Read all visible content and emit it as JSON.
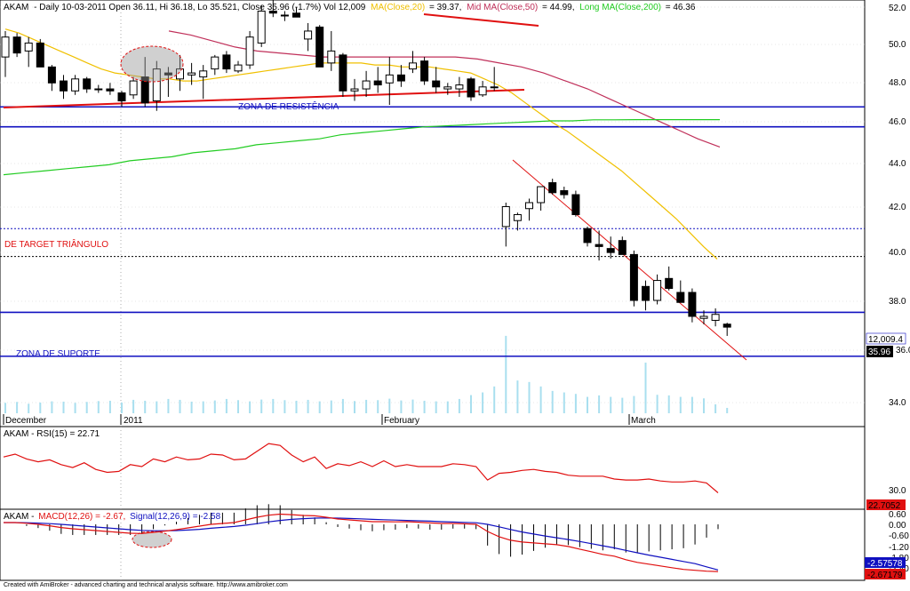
{
  "colors": {
    "up": "#ffffff",
    "down": "#000000",
    "ma20": "#f0c000",
    "ma50": "#c0305a",
    "ma200": "#22cc22",
    "volume": "#a9dfef",
    "zone": "#1010c0",
    "trend": "#e01010",
    "rsi": "#e01010",
    "macd": "#e01010",
    "signal": "#1010c0",
    "pane_border": "#000000"
  },
  "header": {
    "ticker": "AKAM",
    "info": "- Daily 10-03-2011 Open 36.11, Hi 36.18, Lo 35.521, Close 35.96 (-1.7%) Vol 12,009",
    "ma20_label": "MA(Close,20)",
    "ma20_value": "= 39.37,",
    "ma50_label": "Mid MA(Close,50)",
    "ma50_value": "= 44.99,",
    "ma200_label": "Long MA(Close,200)",
    "ma200_value": "= 46.36"
  },
  "annotations": {
    "resistance": "ZONA DE RESISTÊNCIA",
    "target": "DE TARGET TRIÂNGULO",
    "support": "ZONA DE SUPORTE"
  },
  "price_axis": {
    "ticks": [
      "52.0",
      "50.0",
      "48.0",
      "46.0",
      "44.0",
      "42.0",
      "40.0",
      "38.0",
      "36.0",
      "34.0"
    ],
    "volume_label": "12,009.4",
    "close_label": "35.96"
  },
  "x_axis": {
    "labels": [
      "December",
      "2011",
      "February",
      "March"
    ]
  },
  "rsi": {
    "label": "AKAM - RSI(15) = 22.71",
    "tick": "30.0",
    "value_label": "22.7052"
  },
  "macd": {
    "label_ticker": "AKAM -",
    "label_macd": "MACD(12,26) = -2.67,",
    "label_signal": "Signal(12,26,9) = -2.58",
    "ticks": [
      "0.60",
      "0.00",
      "-0.60",
      "-1.20",
      "-1.80",
      "-2.40"
    ],
    "signal_label": "-2.57578",
    "macd_label": "-2.67179"
  },
  "footer": "Created with AmiBroker - advanced charting and technical analysis software. http://www.amibroker.com",
  "chart_data": {
    "type": "candlestick",
    "ylim": [
      33.3,
      52.3
    ],
    "zones": {
      "resistance": [
        47.0,
        46.0
      ],
      "support": [
        36.7,
        34.5
      ],
      "target": [
        40.9,
        39.5
      ]
    },
    "candles": [
      {
        "o": 49.5,
        "h": 50.8,
        "l": 48.5,
        "c": 50.5
      },
      {
        "o": 50.5,
        "h": 50.7,
        "l": 49.5,
        "c": 49.7
      },
      {
        "o": 49.8,
        "h": 50.5,
        "l": 49.0,
        "c": 50.2
      },
      {
        "o": 50.2,
        "h": 50.4,
        "l": 49.0,
        "c": 49.0
      },
      {
        "o": 49.0,
        "h": 49.1,
        "l": 47.8,
        "c": 48.2
      },
      {
        "o": 48.3,
        "h": 48.6,
        "l": 47.4,
        "c": 47.8
      },
      {
        "o": 47.8,
        "h": 48.6,
        "l": 47.6,
        "c": 48.4
      },
      {
        "o": 48.4,
        "h": 48.5,
        "l": 47.7,
        "c": 47.9
      },
      {
        "o": 47.9,
        "h": 48.1,
        "l": 47.7,
        "c": 47.9
      },
      {
        "o": 47.9,
        "h": 48.2,
        "l": 47.6,
        "c": 47.8
      },
      {
        "o": 47.7,
        "h": 47.8,
        "l": 47.0,
        "c": 47.3
      },
      {
        "o": 47.6,
        "h": 48.5,
        "l": 47.4,
        "c": 48.3
      },
      {
        "o": 48.5,
        "h": 49.5,
        "l": 47.0,
        "c": 47.2
      },
      {
        "o": 47.3,
        "h": 49.3,
        "l": 46.8,
        "c": 48.9
      },
      {
        "o": 48.7,
        "h": 49.0,
        "l": 47.5,
        "c": 48.6
      },
      {
        "o": 48.4,
        "h": 49.6,
        "l": 47.8,
        "c": 48.9
      },
      {
        "o": 48.6,
        "h": 49.2,
        "l": 48.1,
        "c": 48.7
      },
      {
        "o": 48.5,
        "h": 49.1,
        "l": 47.4,
        "c": 48.8
      },
      {
        "o": 48.9,
        "h": 49.6,
        "l": 48.6,
        "c": 49.5
      },
      {
        "o": 49.6,
        "h": 49.8,
        "l": 48.7,
        "c": 48.9
      },
      {
        "o": 48.8,
        "h": 49.3,
        "l": 48.7,
        "c": 49.1
      },
      {
        "o": 49.1,
        "h": 50.8,
        "l": 48.9,
        "c": 50.5
      },
      {
        "o": 50.2,
        "h": 52.1,
        "l": 50.0,
        "c": 51.8
      },
      {
        "o": 51.8,
        "h": 52.5,
        "l": 51.5,
        "c": 51.7
      },
      {
        "o": 51.6,
        "h": 51.8,
        "l": 51.3,
        "c": 51.6
      },
      {
        "o": 51.7,
        "h": 52.0,
        "l": 51.5,
        "c": 51.5
      },
      {
        "o": 50.4,
        "h": 51.2,
        "l": 49.8,
        "c": 50.8
      },
      {
        "o": 51.0,
        "h": 51.1,
        "l": 49.0,
        "c": 49.0
      },
      {
        "o": 49.2,
        "h": 50.8,
        "l": 48.8,
        "c": 49.8
      },
      {
        "o": 49.6,
        "h": 49.7,
        "l": 47.5,
        "c": 47.8
      },
      {
        "o": 47.8,
        "h": 48.4,
        "l": 47.3,
        "c": 47.9
      },
      {
        "o": 47.9,
        "h": 48.8,
        "l": 47.5,
        "c": 48.3
      },
      {
        "o": 48.3,
        "h": 49.0,
        "l": 47.7,
        "c": 48.1
      },
      {
        "o": 48.2,
        "h": 49.5,
        "l": 47.1,
        "c": 48.6
      },
      {
        "o": 48.6,
        "h": 49.1,
        "l": 48.0,
        "c": 48.3
      },
      {
        "o": 48.9,
        "h": 49.8,
        "l": 48.7,
        "c": 49.2
      },
      {
        "o": 49.3,
        "h": 49.5,
        "l": 48.1,
        "c": 48.3
      },
      {
        "o": 48.3,
        "h": 49.0,
        "l": 47.7,
        "c": 48.0
      },
      {
        "o": 47.9,
        "h": 48.2,
        "l": 47.6,
        "c": 48.0
      },
      {
        "o": 47.9,
        "h": 48.5,
        "l": 47.5,
        "c": 48.1
      },
      {
        "o": 48.4,
        "h": 48.5,
        "l": 47.3,
        "c": 47.5
      },
      {
        "o": 47.6,
        "h": 48.3,
        "l": 47.5,
        "c": 48.0
      },
      {
        "o": 48.0,
        "h": 49.0,
        "l": 47.8,
        "c": 48.0
      },
      {
        "o": 41.0,
        "h": 42.2,
        "l": 40.0,
        "c": 42.0
      },
      {
        "o": 41.3,
        "h": 41.7,
        "l": 40.8,
        "c": 41.6
      },
      {
        "o": 41.9,
        "h": 42.4,
        "l": 41.3,
        "c": 42.2
      },
      {
        "o": 42.2,
        "h": 43.0,
        "l": 41.8,
        "c": 43.0
      },
      {
        "o": 43.2,
        "h": 43.4,
        "l": 42.6,
        "c": 42.7
      },
      {
        "o": 42.8,
        "h": 43.0,
        "l": 42.4,
        "c": 42.6
      },
      {
        "o": 42.6,
        "h": 42.8,
        "l": 41.5,
        "c": 41.6
      },
      {
        "o": 40.9,
        "h": 41.0,
        "l": 40.0,
        "c": 40.2
      },
      {
        "o": 40.1,
        "h": 40.8,
        "l": 39.3,
        "c": 40.0
      },
      {
        "o": 39.9,
        "h": 40.5,
        "l": 39.4,
        "c": 39.7
      },
      {
        "o": 40.3,
        "h": 40.5,
        "l": 39.6,
        "c": 39.6
      },
      {
        "o": 39.6,
        "h": 39.8,
        "l": 37.0,
        "c": 37.3
      },
      {
        "o": 38.0,
        "h": 38.3,
        "l": 36.8,
        "c": 37.3
      },
      {
        "o": 37.3,
        "h": 38.6,
        "l": 37.1,
        "c": 38.3
      },
      {
        "o": 38.4,
        "h": 39.0,
        "l": 37.8,
        "c": 37.9
      },
      {
        "o": 37.7,
        "h": 38.3,
        "l": 37.3,
        "c": 37.2
      },
      {
        "o": 37.7,
        "h": 37.9,
        "l": 36.2,
        "c": 36.5
      },
      {
        "o": 36.4,
        "h": 36.8,
        "l": 36.1,
        "c": 36.5
      },
      {
        "o": 36.3,
        "h": 36.9,
        "l": 36.0,
        "c": 36.6
      },
      {
        "o": 36.11,
        "h": 36.18,
        "l": 35.521,
        "c": 35.96
      }
    ],
    "volume": [
      3.5,
      3.8,
      3.2,
      3.6,
      4.0,
      3.9,
      3.5,
      3.8,
      4.1,
      4.2,
      3.6,
      4.5,
      4.2,
      4.0,
      4.8,
      4.5,
      3.9,
      4.0,
      4.3,
      4.8,
      4.4,
      4.0,
      4.6,
      4.8,
      4.4,
      4.2,
      4.5,
      4.0,
      4.3,
      4.8,
      4.1,
      4.5,
      4.4,
      4.9,
      4.3,
      4.6,
      4.2,
      4.0,
      4.0,
      4.8,
      6.1,
      7.0,
      9.0,
      26.0,
      11.0,
      10.5,
      9.0,
      7.5,
      7.0,
      6.5,
      5.5,
      6.0,
      5.5,
      5.2,
      5.8,
      17.0,
      6.2,
      6.0,
      5.5,
      5.5,
      5.0,
      3.0,
      1.8
    ],
    "rsi": [
      60,
      63,
      58,
      55,
      57,
      52,
      49,
      54,
      47,
      44,
      45,
      52,
      50,
      58,
      55,
      60,
      57,
      58,
      63,
      62,
      57,
      58,
      66,
      74,
      72,
      62,
      55,
      60,
      48,
      53,
      51,
      55,
      50,
      56,
      50,
      52,
      50,
      50,
      50,
      53,
      52,
      50,
      36,
      43,
      44,
      46,
      47,
      45,
      44,
      41,
      40,
      40,
      40,
      37,
      36,
      36,
      37,
      35,
      34,
      34,
      35,
      33,
      22.71
    ],
    "macd": [
      0.1,
      0.1,
      0.06,
      0.0,
      -0.08,
      -0.18,
      -0.25,
      -0.3,
      -0.35,
      -0.4,
      -0.45,
      -0.5,
      -0.52,
      -0.45,
      -0.38,
      -0.3,
      -0.2,
      -0.1,
      0.0,
      0.05,
      0.1,
      0.25,
      0.4,
      0.52,
      0.58,
      0.55,
      0.5,
      0.48,
      0.4,
      0.3,
      0.25,
      0.2,
      0.15,
      0.15,
      0.14,
      0.15,
      0.12,
      0.08,
      0.05,
      0.05,
      0.03,
      0.0,
      -0.4,
      -0.7,
      -0.9,
      -1.0,
      -1.05,
      -1.1,
      -1.15,
      -1.25,
      -1.4,
      -1.55,
      -1.7,
      -1.8,
      -2.0,
      -2.15,
      -2.25,
      -2.35,
      -2.45,
      -2.55,
      -2.6,
      -2.65,
      -2.67
    ],
    "signal": [
      0.1,
      0.1,
      0.09,
      0.07,
      0.04,
      0.0,
      -0.05,
      -0.1,
      -0.15,
      -0.2,
      -0.25,
      -0.3,
      -0.34,
      -0.36,
      -0.36,
      -0.35,
      -0.32,
      -0.28,
      -0.22,
      -0.17,
      -0.12,
      -0.05,
      0.04,
      0.14,
      0.22,
      0.28,
      0.32,
      0.35,
      0.36,
      0.35,
      0.33,
      0.31,
      0.28,
      0.26,
      0.24,
      0.22,
      0.2,
      0.18,
      0.15,
      0.13,
      0.11,
      0.09,
      0.0,
      -0.14,
      -0.29,
      -0.43,
      -0.55,
      -0.66,
      -0.76,
      -0.86,
      -0.97,
      -1.09,
      -1.21,
      -1.33,
      -1.47,
      -1.61,
      -1.74,
      -1.86,
      -1.98,
      -2.1,
      -2.22,
      -2.4,
      -2.58
    ],
    "ma20": [
      50.9,
      50.7,
      50.4,
      50.1,
      49.8,
      49.5,
      49.2,
      48.9,
      48.7,
      48.6,
      48.5,
      48.4,
      48.4,
      48.3,
      48.3,
      48.4,
      48.5,
      48.6,
      48.7,
      48.8,
      48.9,
      49.0,
      49.1,
      49.2,
      49.2,
      49.2,
      49.2,
      49.1,
      49.1,
      49.0,
      49.0,
      49.0,
      48.9,
      48.8,
      48.7,
      48.4,
      48.1,
      47.7,
      47.2,
      46.7,
      46.2,
      45.8,
      45.3,
      44.8,
      44.3,
      43.8,
      43.2,
      42.6,
      42.0,
      41.4,
      40.7,
      40.0,
      39.37
    ],
    "ma50": [
      50.8,
      50.6,
      50.3,
      50.0,
      49.8,
      49.7,
      49.6,
      49.5,
      49.5,
      49.5,
      49.5,
      49.5,
      49.5,
      49.5,
      49.4,
      49.2,
      49.0,
      48.7,
      48.3,
      47.9,
      47.4,
      46.9,
      46.4,
      45.9,
      45.4,
      44.99
    ],
    "ma200": [
      43.6,
      43.7,
      43.8,
      43.9,
      44.0,
      44.1,
      44.3,
      44.4,
      44.5,
      44.7,
      44.8,
      44.9,
      45.1,
      45.2,
      45.3,
      45.4,
      45.6,
      45.7,
      45.8,
      45.9,
      46.0,
      46.05,
      46.1,
      46.15,
      46.2,
      46.25,
      46.3,
      46.3,
      46.35,
      46.35,
      46.36,
      46.36,
      46.36,
      46.36,
      46.36
    ]
  }
}
